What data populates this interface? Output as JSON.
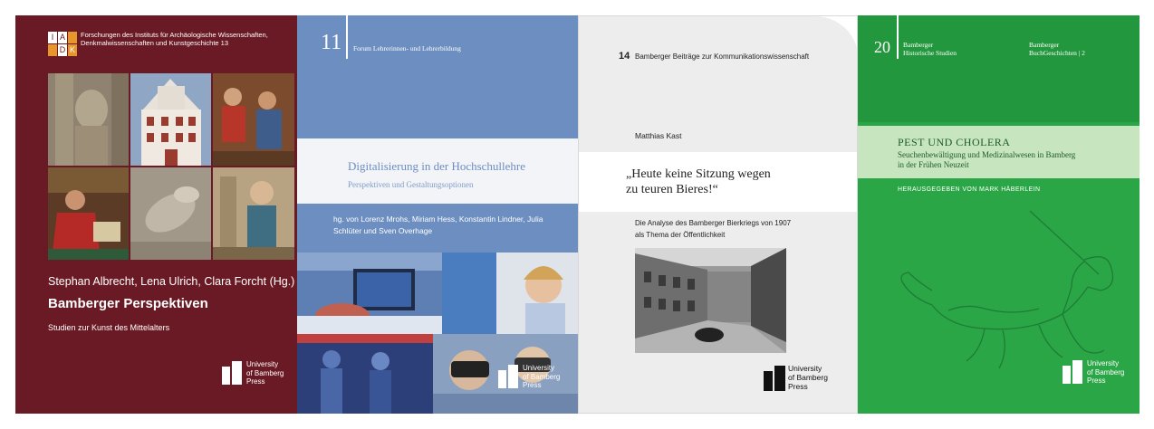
{
  "covers": [
    {
      "logo": [
        "I",
        "A",
        "",
        "",
        "D",
        "K"
      ],
      "series": "Forschungen des Instituts für Archäologische Wissenschaften, Denkmalwissenschaften und Kunstgeschichte 13",
      "authors": "Stephan Albrecht, Lena Ulrich, Clara Forcht (Hg.)",
      "title": "Bamberger Perspektiven",
      "subtitle": "Studien zur Kunst des Mittelalters",
      "publisher": [
        "University",
        "of Bamberg",
        "Press"
      ]
    },
    {
      "number": "11",
      "series": "Forum Lehrerinnen- und Lehrerbildung",
      "title": "Digitalisierung in der Hochschullehre",
      "subtitle": "Perspektiven und Gestaltungsoptionen",
      "editors": "hg. von Lorenz Mrohs, Miriam Hess, Konstantin Lindner, Julia Schlüter und Sven Overhage",
      "publisher": [
        "University",
        "of Bamberg",
        "Press"
      ]
    },
    {
      "number": "14",
      "series": "Bamberger Beiträge zur Kommunikationswissenschaft",
      "author": "Matthias Kast",
      "title_lines": [
        "„Heute keine Sitzung wegen",
        "zu teuren Bieres!“"
      ],
      "subtitle_lines": [
        "Die Analyse des Bamberger Bierkriegs von 1907",
        "als Thema der Öffentlichkeit"
      ],
      "publisher": [
        "University",
        "of Bamberg",
        "Press"
      ]
    },
    {
      "number": "20",
      "series_left": [
        "Bamberger",
        "Historische Studien"
      ],
      "series_right": [
        "Bamberger",
        "BuchGeschichten | 2"
      ],
      "title": "PEST UND CHOLERA",
      "subtitle_lines": [
        "Seuchenbewältigung und Medizinalwesen in Bamberg",
        "in der Frühen Neuzeit"
      ],
      "editor": "HERAUSGEGEBEN VON MARK HÄBERLEIN",
      "publisher": [
        "University",
        "of Bamberg",
        "Press"
      ]
    }
  ],
  "colors": {
    "cover1_bg": "#6a1a24",
    "cover2_bg": "#6c8ec0",
    "cover3_bg": "#ededed",
    "cover4_bg": "#2aa646"
  }
}
